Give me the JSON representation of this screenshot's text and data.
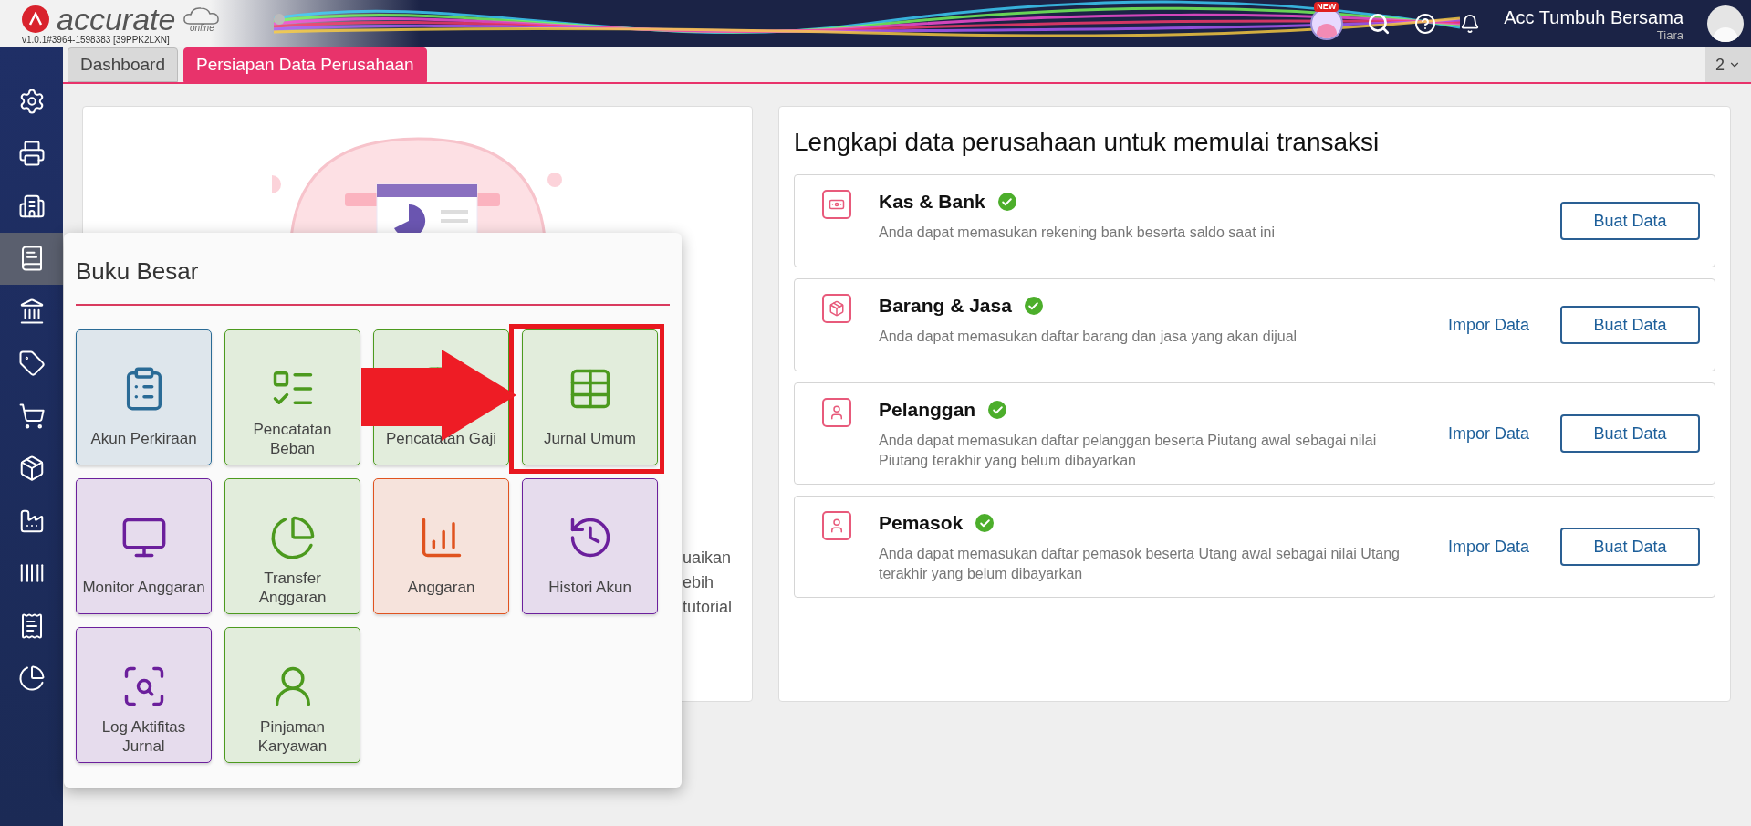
{
  "header": {
    "logo_text": "accurate",
    "logo_sub": "online",
    "version": "v1.0.1#3964-1598383 [39PPK2LXN]",
    "new_badge": "NEW",
    "user_name": "Acc Tumbuh Bersama",
    "user_sub": "Tiara"
  },
  "tabs": [
    {
      "label": "Dashboard",
      "selected": false
    },
    {
      "label": "Persiapan Data Perusahaan",
      "selected": true
    }
  ],
  "tab_count": "2",
  "sidebar": {
    "items": [
      {
        "selected": false
      },
      {
        "selected": false
      },
      {
        "selected": false
      },
      {
        "selected": true
      },
      {
        "selected": false
      },
      {
        "selected": false
      },
      {
        "selected": false
      },
      {
        "selected": false
      },
      {
        "selected": false
      },
      {
        "selected": false
      },
      {
        "selected": false
      },
      {
        "selected": false
      }
    ]
  },
  "left_card": {
    "text_fragments": [
      "uaikan",
      "ebih",
      "tutorial"
    ]
  },
  "setup_card": {
    "title": "Lengkapi data perusahaan untuk memulai transaksi",
    "items": [
      {
        "title": "Kas & Bank",
        "checked": true,
        "description": "Anda dapat memasukan rekening bank beserta saldo saat ini",
        "button": "Buat Data"
      },
      {
        "title": "Barang & Jasa",
        "checked": true,
        "description": "Anda dapat memasukan daftar barang dan jasa yang akan dijual",
        "import": "Impor Data",
        "button": "Buat Data"
      },
      {
        "title": "Pelanggan",
        "checked": true,
        "description": "Anda dapat memasukan daftar pelanggan beserta Piutang awal sebagai nilai Piutang terakhir yang belum dibayarkan",
        "import": "Impor Data",
        "button": "Buat Data"
      },
      {
        "title": "Pemasok",
        "checked": true,
        "description": "Anda dapat memasukan daftar pemasok beserta Utang awal sebagai nilai Utang terakhir yang belum dibayarkan",
        "import": "Impor Data",
        "button": "Buat Data"
      }
    ]
  },
  "menu_popup": {
    "title": "Buku Besar",
    "tiles": [
      {
        "label": "Akun Perkiraan",
        "color": "#2a6b96",
        "highlighted": false
      },
      {
        "label": "Pencatatan Beban",
        "color": "#4c9a1e",
        "highlighted": false
      },
      {
        "label": "Pencatatan Gaji",
        "color": "#4c9a1e",
        "highlighted": false
      },
      {
        "label": "Jurnal Umum",
        "color": "#4c9a1e",
        "highlighted": true
      },
      {
        "label": "Monitor Anggaran",
        "color": "#6b1f9c",
        "highlighted": false
      },
      {
        "label": "Transfer Anggaran",
        "color": "#4c9a1e",
        "highlighted": false
      },
      {
        "label": "Anggaran",
        "color": "#e0531f",
        "highlighted": false
      },
      {
        "label": "Histori Akun",
        "color": "#6b1f9c",
        "highlighted": false
      },
      {
        "label": "Log Aktifitas Jurnal",
        "color": "#6b1f9c",
        "highlighted": false
      },
      {
        "label": "Pinjaman Karyawan",
        "color": "#4c9a1e",
        "highlighted": false
      }
    ]
  }
}
